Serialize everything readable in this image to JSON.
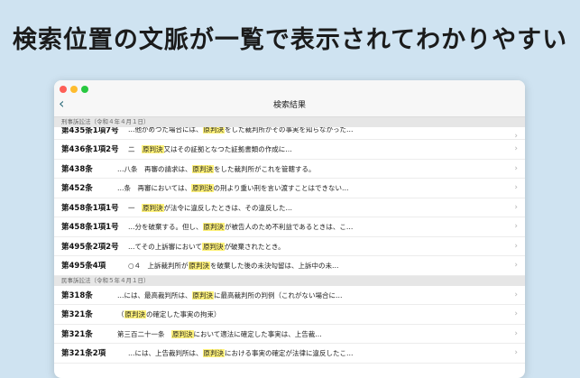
{
  "headline": "検索位置の文脈が一覧で表示されてわかりやすい",
  "window": {
    "title": "検索結果",
    "back_icon": "chevron-left-icon"
  },
  "sections": [
    {
      "header": "刑事訴訟法（令和４年４月１日）",
      "rows": [
        {
          "art": "第435条1項7号",
          "pre": "…他がめつた場合には、",
          "hl": "原判決",
          "post": "をした裁判所がその事実を知らなかった…",
          "partial": true
        },
        {
          "art": "第436条1項2号",
          "pre": "二　",
          "hl": "原判決",
          "post": "又はその証拠となつた証拠書類の作成に…"
        },
        {
          "art": "第438条",
          "pre": "…八条　再審の請求は、",
          "hl": "原判決",
          "post": "をした裁判所がこれを管轄する。"
        },
        {
          "art": "第452条",
          "pre": "…条　再審においては、",
          "hl": "原判決",
          "post": "の刑より重い刑を言い渡すことはできない…"
        },
        {
          "art": "第458条1項1号",
          "pre": "一　",
          "hl": "原判決",
          "post": "が法令に違反したときは、その違反した…"
        },
        {
          "art": "第458条1項1号",
          "pre": "…分を破棄する。但し、",
          "hl": "原判決",
          "post": "が被告人のため不利益であるときは、こ…"
        },
        {
          "art": "第495条2項2号",
          "pre": "…てその上訴審において",
          "hl": "原判決",
          "post": "が破棄されたとき。"
        },
        {
          "art": "第495条4項",
          "pre": "○４　上訴裁判所が",
          "hl": "原判決",
          "post": "を破棄した後の未決勾留は、上訴中の未…"
        }
      ]
    },
    {
      "header": "民事訴訟法（令和５年４月１日）",
      "rows": [
        {
          "art": "第318条",
          "pre": "…には、最高裁判所は、",
          "hl": "原判決",
          "post": "に最高裁判所の判例（これがない場合に…"
        },
        {
          "art": "第321条",
          "pre": "（",
          "hl": "原判決",
          "post": "の確定した事実の拘束）"
        },
        {
          "art": "第321条",
          "pre": "第三百二十一条　",
          "hl": "原判決",
          "post": "において適法に確定した事実は、上告裁…"
        },
        {
          "art": "第321条2項",
          "pre": "…には、上告裁判所は、",
          "hl": "原判決",
          "post": "における事実の確定が法律に違反したこ…"
        }
      ]
    }
  ]
}
